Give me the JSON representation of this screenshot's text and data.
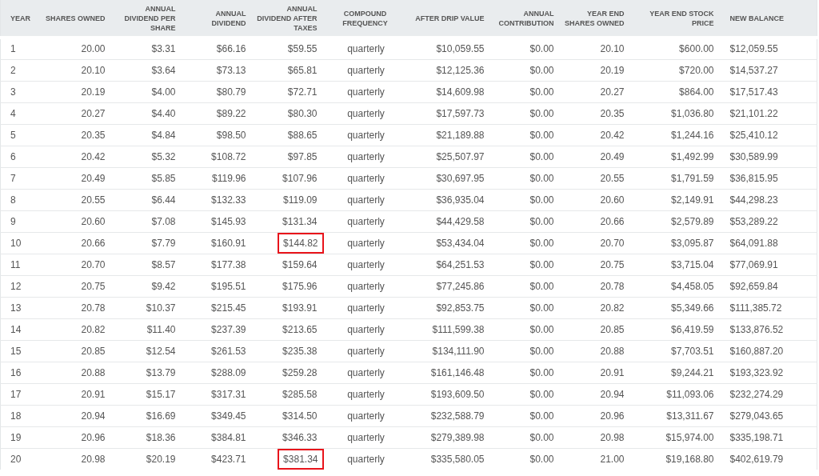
{
  "table": {
    "columns": [
      {
        "label": "YEAR",
        "kind": "index"
      },
      {
        "label": "SHARES OWNED",
        "kind": "number"
      },
      {
        "label": "ANNUAL DIVIDEND PER SHARE",
        "kind": "number"
      },
      {
        "label": "ANNUAL DIVIDEND",
        "kind": "number"
      },
      {
        "label": "ANNUAL DIVIDEND AFTER TAXES",
        "kind": "number"
      },
      {
        "label": "COMPOUND FREQUENCY",
        "kind": "frequency"
      },
      {
        "label": "AFTER DRIP VALUE",
        "kind": "number"
      },
      {
        "label": "ANNUAL CONTRIBUTION",
        "kind": "number"
      },
      {
        "label": "YEAR END SHARES OWNED",
        "kind": "number"
      },
      {
        "label": "YEAR END STOCK PRICE",
        "kind": "number"
      },
      {
        "label": "NEW BALANCE",
        "kind": "balance"
      }
    ],
    "rows": [
      {
        "cells": [
          {
            "text": "1",
            "boxed": false
          },
          {
            "text": "20.00",
            "boxed": false
          },
          {
            "text": "$3.31",
            "boxed": false
          },
          {
            "text": "$66.16",
            "boxed": false
          },
          {
            "text": "$59.55",
            "boxed": false
          },
          {
            "text": "quarterly",
            "boxed": false
          },
          {
            "text": "$10,059.55",
            "boxed": false
          },
          {
            "text": "$0.00",
            "boxed": false
          },
          {
            "text": "20.10",
            "boxed": false
          },
          {
            "text": "$600.00",
            "boxed": false
          },
          {
            "text": "$12,059.55",
            "boxed": false
          }
        ]
      },
      {
        "cells": [
          {
            "text": "2",
            "boxed": false
          },
          {
            "text": "20.10",
            "boxed": false
          },
          {
            "text": "$3.64",
            "boxed": false
          },
          {
            "text": "$73.13",
            "boxed": false
          },
          {
            "text": "$65.81",
            "boxed": false
          },
          {
            "text": "quarterly",
            "boxed": false
          },
          {
            "text": "$12,125.36",
            "boxed": false
          },
          {
            "text": "$0.00",
            "boxed": false
          },
          {
            "text": "20.19",
            "boxed": false
          },
          {
            "text": "$720.00",
            "boxed": false
          },
          {
            "text": "$14,537.27",
            "boxed": false
          }
        ]
      },
      {
        "cells": [
          {
            "text": "3",
            "boxed": false
          },
          {
            "text": "20.19",
            "boxed": false
          },
          {
            "text": "$4.00",
            "boxed": false
          },
          {
            "text": "$80.79",
            "boxed": false
          },
          {
            "text": "$72.71",
            "boxed": false
          },
          {
            "text": "quarterly",
            "boxed": false
          },
          {
            "text": "$14,609.98",
            "boxed": false
          },
          {
            "text": "$0.00",
            "boxed": false
          },
          {
            "text": "20.27",
            "boxed": false
          },
          {
            "text": "$864.00",
            "boxed": false
          },
          {
            "text": "$17,517.43",
            "boxed": false
          }
        ]
      },
      {
        "cells": [
          {
            "text": "4",
            "boxed": false
          },
          {
            "text": "20.27",
            "boxed": false
          },
          {
            "text": "$4.40",
            "boxed": false
          },
          {
            "text": "$89.22",
            "boxed": false
          },
          {
            "text": "$80.30",
            "boxed": false
          },
          {
            "text": "quarterly",
            "boxed": false
          },
          {
            "text": "$17,597.73",
            "boxed": false
          },
          {
            "text": "$0.00",
            "boxed": false
          },
          {
            "text": "20.35",
            "boxed": false
          },
          {
            "text": "$1,036.80",
            "boxed": false
          },
          {
            "text": "$21,101.22",
            "boxed": false
          }
        ]
      },
      {
        "cells": [
          {
            "text": "5",
            "boxed": false
          },
          {
            "text": "20.35",
            "boxed": false
          },
          {
            "text": "$4.84",
            "boxed": false
          },
          {
            "text": "$98.50",
            "boxed": false
          },
          {
            "text": "$88.65",
            "boxed": false
          },
          {
            "text": "quarterly",
            "boxed": false
          },
          {
            "text": "$21,189.88",
            "boxed": false
          },
          {
            "text": "$0.00",
            "boxed": false
          },
          {
            "text": "20.42",
            "boxed": false
          },
          {
            "text": "$1,244.16",
            "boxed": false
          },
          {
            "text": "$25,410.12",
            "boxed": false
          }
        ]
      },
      {
        "cells": [
          {
            "text": "6",
            "boxed": false
          },
          {
            "text": "20.42",
            "boxed": false
          },
          {
            "text": "$5.32",
            "boxed": false
          },
          {
            "text": "$108.72",
            "boxed": false
          },
          {
            "text": "$97.85",
            "boxed": false
          },
          {
            "text": "quarterly",
            "boxed": false
          },
          {
            "text": "$25,507.97",
            "boxed": false
          },
          {
            "text": "$0.00",
            "boxed": false
          },
          {
            "text": "20.49",
            "boxed": false
          },
          {
            "text": "$1,492.99",
            "boxed": false
          },
          {
            "text": "$30,589.99",
            "boxed": false
          }
        ]
      },
      {
        "cells": [
          {
            "text": "7",
            "boxed": false
          },
          {
            "text": "20.49",
            "boxed": false
          },
          {
            "text": "$5.85",
            "boxed": false
          },
          {
            "text": "$119.96",
            "boxed": false
          },
          {
            "text": "$107.96",
            "boxed": false
          },
          {
            "text": "quarterly",
            "boxed": false
          },
          {
            "text": "$30,697.95",
            "boxed": false
          },
          {
            "text": "$0.00",
            "boxed": false
          },
          {
            "text": "20.55",
            "boxed": false
          },
          {
            "text": "$1,791.59",
            "boxed": false
          },
          {
            "text": "$36,815.95",
            "boxed": false
          }
        ]
      },
      {
        "cells": [
          {
            "text": "8",
            "boxed": false
          },
          {
            "text": "20.55",
            "boxed": false
          },
          {
            "text": "$6.44",
            "boxed": false
          },
          {
            "text": "$132.33",
            "boxed": false
          },
          {
            "text": "$119.09",
            "boxed": false
          },
          {
            "text": "quarterly",
            "boxed": false
          },
          {
            "text": "$36,935.04",
            "boxed": false
          },
          {
            "text": "$0.00",
            "boxed": false
          },
          {
            "text": "20.60",
            "boxed": false
          },
          {
            "text": "$2,149.91",
            "boxed": false
          },
          {
            "text": "$44,298.23",
            "boxed": false
          }
        ]
      },
      {
        "cells": [
          {
            "text": "9",
            "boxed": false
          },
          {
            "text": "20.60",
            "boxed": false
          },
          {
            "text": "$7.08",
            "boxed": false
          },
          {
            "text": "$145.93",
            "boxed": false
          },
          {
            "text": "$131.34",
            "boxed": false
          },
          {
            "text": "quarterly",
            "boxed": false
          },
          {
            "text": "$44,429.58",
            "boxed": false
          },
          {
            "text": "$0.00",
            "boxed": false
          },
          {
            "text": "20.66",
            "boxed": false
          },
          {
            "text": "$2,579.89",
            "boxed": false
          },
          {
            "text": "$53,289.22",
            "boxed": false
          }
        ]
      },
      {
        "cells": [
          {
            "text": "10",
            "boxed": false
          },
          {
            "text": "20.66",
            "boxed": false
          },
          {
            "text": "$7.79",
            "boxed": false
          },
          {
            "text": "$160.91",
            "boxed": false
          },
          {
            "text": "$144.82",
            "boxed": true
          },
          {
            "text": "quarterly",
            "boxed": false
          },
          {
            "text": "$53,434.04",
            "boxed": false
          },
          {
            "text": "$0.00",
            "boxed": false
          },
          {
            "text": "20.70",
            "boxed": false
          },
          {
            "text": "$3,095.87",
            "boxed": false
          },
          {
            "text": "$64,091.88",
            "boxed": false
          }
        ]
      },
      {
        "cells": [
          {
            "text": "11",
            "boxed": false
          },
          {
            "text": "20.70",
            "boxed": false
          },
          {
            "text": "$8.57",
            "boxed": false
          },
          {
            "text": "$177.38",
            "boxed": false
          },
          {
            "text": "$159.64",
            "boxed": false
          },
          {
            "text": "quarterly",
            "boxed": false
          },
          {
            "text": "$64,251.53",
            "boxed": false
          },
          {
            "text": "$0.00",
            "boxed": false
          },
          {
            "text": "20.75",
            "boxed": false
          },
          {
            "text": "$3,715.04",
            "boxed": false
          },
          {
            "text": "$77,069.91",
            "boxed": false
          }
        ]
      },
      {
        "cells": [
          {
            "text": "12",
            "boxed": false
          },
          {
            "text": "20.75",
            "boxed": false
          },
          {
            "text": "$9.42",
            "boxed": false
          },
          {
            "text": "$195.51",
            "boxed": false
          },
          {
            "text": "$175.96",
            "boxed": false
          },
          {
            "text": "quarterly",
            "boxed": false
          },
          {
            "text": "$77,245.86",
            "boxed": false
          },
          {
            "text": "$0.00",
            "boxed": false
          },
          {
            "text": "20.78",
            "boxed": false
          },
          {
            "text": "$4,458.05",
            "boxed": false
          },
          {
            "text": "$92,659.84",
            "boxed": false
          }
        ]
      },
      {
        "cells": [
          {
            "text": "13",
            "boxed": false
          },
          {
            "text": "20.78",
            "boxed": false
          },
          {
            "text": "$10.37",
            "boxed": false
          },
          {
            "text": "$215.45",
            "boxed": false
          },
          {
            "text": "$193.91",
            "boxed": false
          },
          {
            "text": "quarterly",
            "boxed": false
          },
          {
            "text": "$92,853.75",
            "boxed": false
          },
          {
            "text": "$0.00",
            "boxed": false
          },
          {
            "text": "20.82",
            "boxed": false
          },
          {
            "text": "$5,349.66",
            "boxed": false
          },
          {
            "text": "$111,385.72",
            "boxed": false
          }
        ]
      },
      {
        "cells": [
          {
            "text": "14",
            "boxed": false
          },
          {
            "text": "20.82",
            "boxed": false
          },
          {
            "text": "$11.40",
            "boxed": false
          },
          {
            "text": "$237.39",
            "boxed": false
          },
          {
            "text": "$213.65",
            "boxed": false
          },
          {
            "text": "quarterly",
            "boxed": false
          },
          {
            "text": "$111,599.38",
            "boxed": false
          },
          {
            "text": "$0.00",
            "boxed": false
          },
          {
            "text": "20.85",
            "boxed": false
          },
          {
            "text": "$6,419.59",
            "boxed": false
          },
          {
            "text": "$133,876.52",
            "boxed": false
          }
        ]
      },
      {
        "cells": [
          {
            "text": "15",
            "boxed": false
          },
          {
            "text": "20.85",
            "boxed": false
          },
          {
            "text": "$12.54",
            "boxed": false
          },
          {
            "text": "$261.53",
            "boxed": false
          },
          {
            "text": "$235.38",
            "boxed": false
          },
          {
            "text": "quarterly",
            "boxed": false
          },
          {
            "text": "$134,111.90",
            "boxed": false
          },
          {
            "text": "$0.00",
            "boxed": false
          },
          {
            "text": "20.88",
            "boxed": false
          },
          {
            "text": "$7,703.51",
            "boxed": false
          },
          {
            "text": "$160,887.20",
            "boxed": false
          }
        ]
      },
      {
        "cells": [
          {
            "text": "16",
            "boxed": false
          },
          {
            "text": "20.88",
            "boxed": false
          },
          {
            "text": "$13.79",
            "boxed": false
          },
          {
            "text": "$288.09",
            "boxed": false
          },
          {
            "text": "$259.28",
            "boxed": false
          },
          {
            "text": "quarterly",
            "boxed": false
          },
          {
            "text": "$161,146.48",
            "boxed": false
          },
          {
            "text": "$0.00",
            "boxed": false
          },
          {
            "text": "20.91",
            "boxed": false
          },
          {
            "text": "$9,244.21",
            "boxed": false
          },
          {
            "text": "$193,323.92",
            "boxed": false
          }
        ]
      },
      {
        "cells": [
          {
            "text": "17",
            "boxed": false
          },
          {
            "text": "20.91",
            "boxed": false
          },
          {
            "text": "$15.17",
            "boxed": false
          },
          {
            "text": "$317.31",
            "boxed": false
          },
          {
            "text": "$285.58",
            "boxed": false
          },
          {
            "text": "quarterly",
            "boxed": false
          },
          {
            "text": "$193,609.50",
            "boxed": false
          },
          {
            "text": "$0.00",
            "boxed": false
          },
          {
            "text": "20.94",
            "boxed": false
          },
          {
            "text": "$11,093.06",
            "boxed": false
          },
          {
            "text": "$232,274.29",
            "boxed": false
          }
        ]
      },
      {
        "cells": [
          {
            "text": "18",
            "boxed": false
          },
          {
            "text": "20.94",
            "boxed": false
          },
          {
            "text": "$16.69",
            "boxed": false
          },
          {
            "text": "$349.45",
            "boxed": false
          },
          {
            "text": "$314.50",
            "boxed": false
          },
          {
            "text": "quarterly",
            "boxed": false
          },
          {
            "text": "$232,588.79",
            "boxed": false
          },
          {
            "text": "$0.00",
            "boxed": false
          },
          {
            "text": "20.96",
            "boxed": false
          },
          {
            "text": "$13,311.67",
            "boxed": false
          },
          {
            "text": "$279,043.65",
            "boxed": false
          }
        ]
      },
      {
        "cells": [
          {
            "text": "19",
            "boxed": false
          },
          {
            "text": "20.96",
            "boxed": false
          },
          {
            "text": "$18.36",
            "boxed": false
          },
          {
            "text": "$384.81",
            "boxed": false
          },
          {
            "text": "$346.33",
            "boxed": false
          },
          {
            "text": "quarterly",
            "boxed": false
          },
          {
            "text": "$279,389.98",
            "boxed": false
          },
          {
            "text": "$0.00",
            "boxed": false
          },
          {
            "text": "20.98",
            "boxed": false
          },
          {
            "text": "$15,974.00",
            "boxed": false
          },
          {
            "text": "$335,198.71",
            "boxed": false
          }
        ]
      },
      {
        "cells": [
          {
            "text": "20",
            "boxed": false
          },
          {
            "text": "20.98",
            "boxed": false
          },
          {
            "text": "$20.19",
            "boxed": false
          },
          {
            "text": "$423.71",
            "boxed": false
          },
          {
            "text": "$381.34",
            "boxed": true
          },
          {
            "text": "quarterly",
            "boxed": false
          },
          {
            "text": "$335,580.05",
            "boxed": false
          },
          {
            "text": "$0.00",
            "boxed": false
          },
          {
            "text": "21.00",
            "boxed": false
          },
          {
            "text": "$19,168.80",
            "boxed": false
          },
          {
            "text": "$402,619.79",
            "boxed": false
          }
        ]
      }
    ]
  }
}
